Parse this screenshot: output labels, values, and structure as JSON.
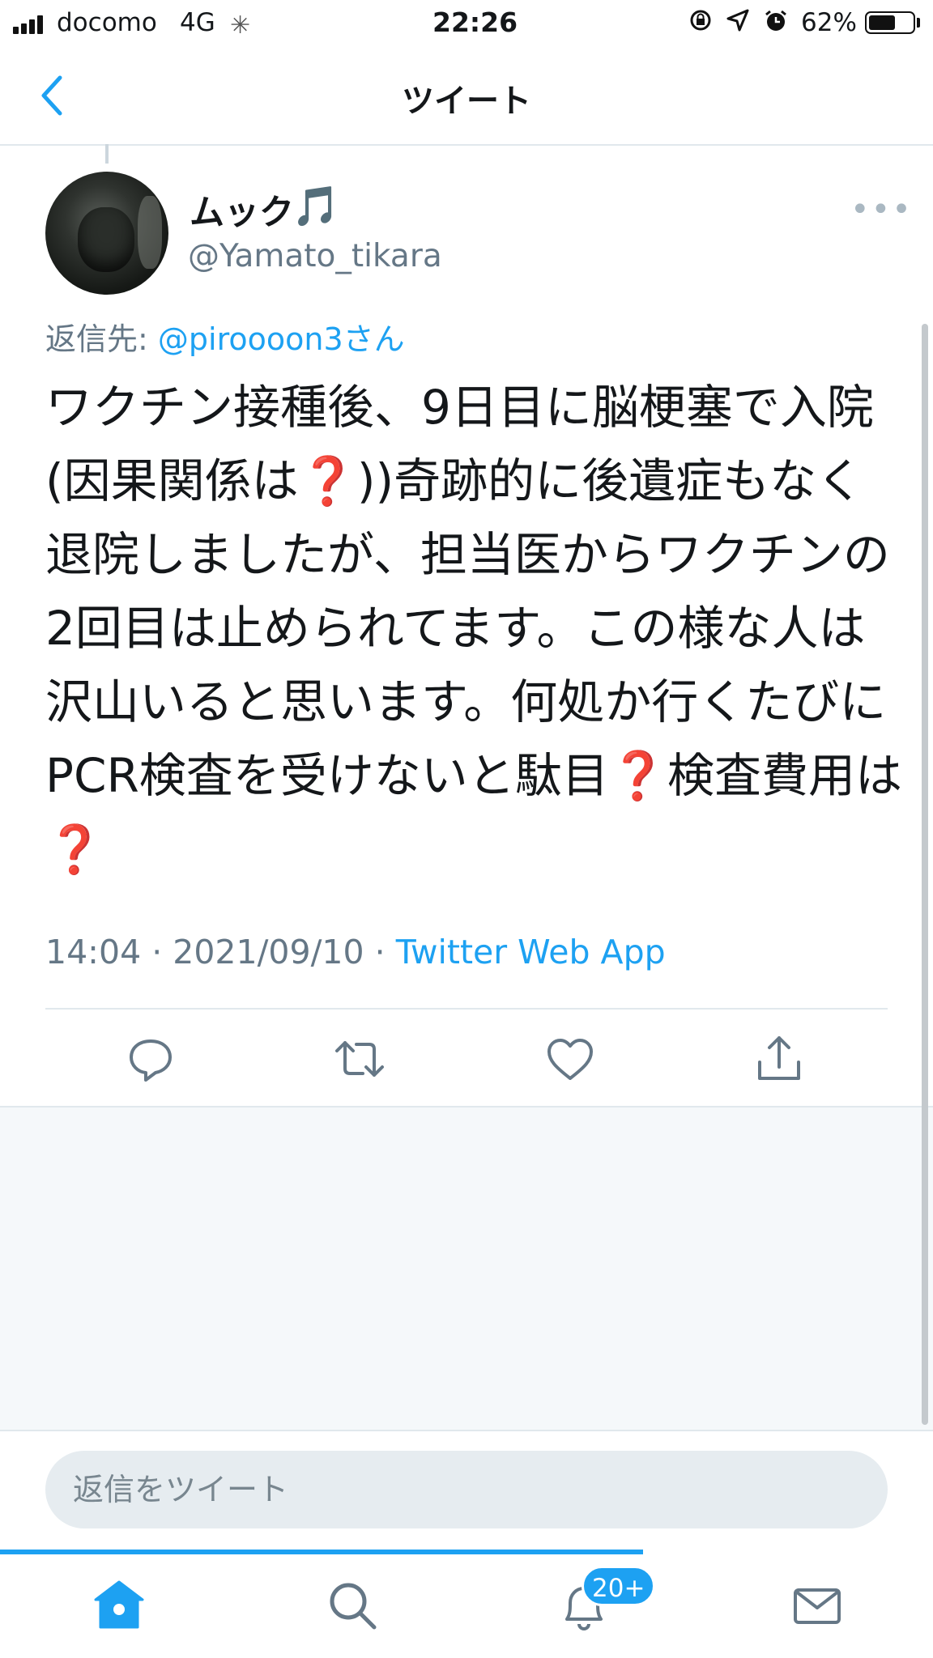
{
  "status_bar": {
    "carrier": "docomo",
    "network": "4G",
    "time": "22:26",
    "battery_percent": "62%",
    "battery_level": 0.62
  },
  "nav": {
    "title": "ツイート",
    "back_icon": "chevron-left-icon"
  },
  "tweet": {
    "display_name": "ムック",
    "display_name_emoji": "🎵",
    "handle": "@Yamato_tikara",
    "reply_prefix": "返信先: ",
    "reply_mention": "@piroooon3さん",
    "text_parts": {
      "p1": "ワクチン接種後、9日目に脳梗塞で入院(因果関係は",
      "q1": "❓",
      "p2": "))奇跡的に後遺症もなく退院しましたが、担当医からワクチンの2回目は止められてます。この様な人は沢山いると思います。何処か行くたびにPCR検査を受けないと駄目",
      "q2": "❓",
      "p3": "検査費用は",
      "q3": "❓"
    },
    "time": "14:04",
    "date": "2021/09/10",
    "separator": " · ",
    "source": "Twitter Web App"
  },
  "actions": [
    "reply-icon",
    "retweet-icon",
    "like-icon",
    "share-icon"
  ],
  "reply_box": {
    "placeholder": "返信をツイート"
  },
  "tab_bar": {
    "items": [
      "home-icon",
      "search-icon",
      "notifications-icon",
      "messages-icon"
    ],
    "notification_badge": "20+",
    "active": "home"
  },
  "colors": {
    "accent": "#1da1f2",
    "text": "#14171a",
    "secondary": "#657786",
    "emoji_red": "#e0132c"
  }
}
